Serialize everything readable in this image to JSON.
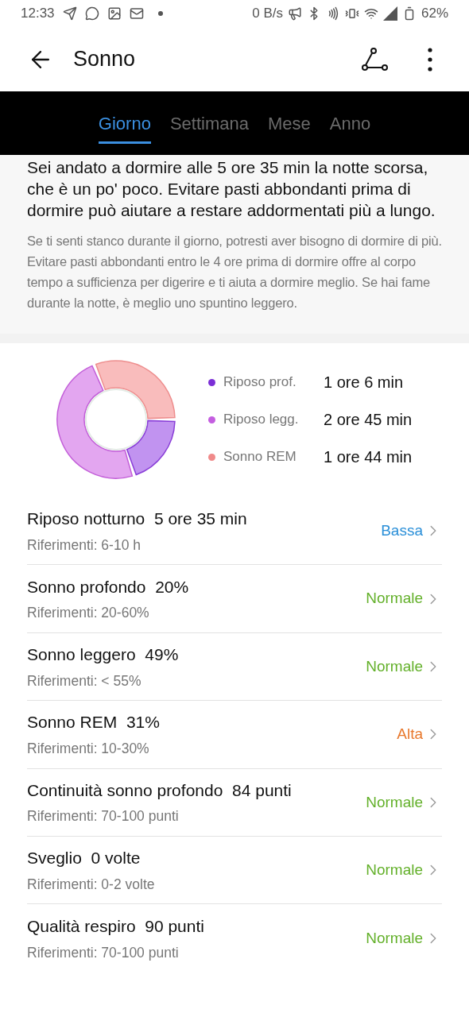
{
  "status_bar": {
    "time": "12:33",
    "speed": "0 B/s",
    "battery": "62%"
  },
  "header": {
    "title": "Sonno"
  },
  "tabs": [
    {
      "label": "Giorno",
      "selected": true
    },
    {
      "label": "Settimana",
      "selected": false
    },
    {
      "label": "Mese",
      "selected": false
    },
    {
      "label": "Anno",
      "selected": false
    }
  ],
  "summary": {
    "headline": "Sei andato a dormire alle 5 ore 35 min la notte scorsa, che è un po' poco. Evitare pasti abbondanti prima di dormire può aiutare a restare addormentati più a lungo.",
    "body": "Se ti senti stanco durante il giorno, potresti aver bisogno di dormire di più. Evitare pasti abbondanti entro le 4 ore prima di dormire offre al corpo tempo a sufficienza per digerire e ti aiuta a dormire meglio. Se hai fame durante la notte, è meglio uno spuntino leggero."
  },
  "legend": [
    {
      "label": "Riposo prof.",
      "value": "1 ore 6 min",
      "color": "#7b2fd6"
    },
    {
      "label": "Riposo legg.",
      "value": "2 ore 45 min",
      "color": "#c45ee0"
    },
    {
      "label": "Sonno REM",
      "value": "1 ore 44 min",
      "color": "#f08a8a"
    }
  ],
  "metrics": [
    {
      "title": "Riposo notturno",
      "value": "5 ore 35 min",
      "reference": "Riferimenti: 6-10 h",
      "status": "Bassa",
      "kind": "low"
    },
    {
      "title": "Sonno profondo",
      "value": "20%",
      "reference": "Riferimenti: 20-60%",
      "status": "Normale",
      "kind": "normal"
    },
    {
      "title": "Sonno leggero",
      "value": "49%",
      "reference": "Riferimenti: < 55%",
      "status": "Normale",
      "kind": "normal"
    },
    {
      "title": "Sonno REM",
      "value": "31%",
      "reference": "Riferimenti: 10-30%",
      "status": "Alta",
      "kind": "high"
    },
    {
      "title": "Continuità sonno profondo",
      "value": "84 punti",
      "reference": "Riferimenti: 70-100 punti",
      "status": "Normale",
      "kind": "normal"
    },
    {
      "title": "Sveglio",
      "value": "0 volte",
      "reference": "Riferimenti: 0-2 volte",
      "status": "Normale",
      "kind": "normal"
    },
    {
      "title": "Qualità respiro",
      "value": "90 punti",
      "reference": "Riferimenti: 70-100 punti",
      "status": "Normale",
      "kind": "normal"
    }
  ]
}
